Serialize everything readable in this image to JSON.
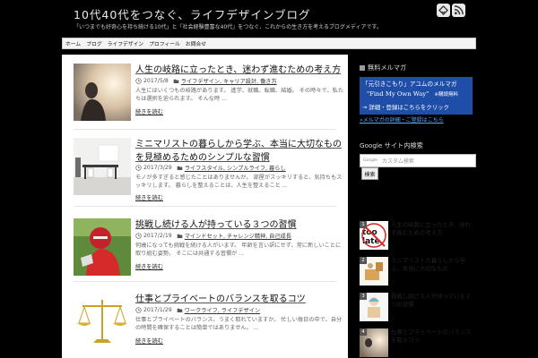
{
  "header": {
    "title": "10代40代をつなぐ、ライフデザインブログ",
    "description": "「いつまでも好奇心を持ち続ける10代」と「社会経験豊富な40代」をつなぐ、これからの生き方を考えるブログメディアです。",
    "icons": [
      "feedly-icon",
      "rss-icon"
    ]
  },
  "nav": {
    "items": [
      "ホーム",
      "ブログ",
      "ライフデザイン",
      "プロフィール",
      "お問合せ"
    ]
  },
  "posts": [
    {
      "title": "人生の岐路に立ったとき、迷わず進むための考え方",
      "date": "2017/5/8",
      "categories": "ライフデザイン, キャリア設計, 働き方",
      "excerpt": "人生にはいくつもの岐路があります。 進学、就職、転職、結婚。 その時々で、私たちは選択を迫られます。 そんな時 ...",
      "more": "続きを読む"
    },
    {
      "title": "ミニマリストの暮らしから学ぶ、本当に大切なものを見極めるためのシンプルな習慣",
      "date": "2017/3/29",
      "categories": "ライフスタイル, シンプルライフ, 暮らし",
      "excerpt": "モノが多すぎると感じたことはありませんか。 部屋がスッキリすると、気持ちもスッキリします。 暮らしを整えることは、人生を整えること ...",
      "more": "続きを読む"
    },
    {
      "title": "挑戦し続ける人が持っている３つの習慣",
      "date": "2017/2/19",
      "categories": "マインドセット, チャレンジ精神, 自己成長",
      "excerpt": "何歳になっても挑戦を続ける人がいます。 年齢を言い訳にせず、常に新しいことに取り組む姿勢。 そこには共通する習慣が ...",
      "more": "続きを読む"
    },
    {
      "title": "仕事とプライベートのバランスを取るコツ",
      "date": "2017/1/29",
      "categories": "ワークライフ, ライフデザイン",
      "excerpt": "仕事とプライベートのバランス、うまく取れていますか。 忙しい毎日の中で、自分の時間を確保することは簡単ではありません。 ...",
      "more": "続きを読む"
    }
  ],
  "sidebar": {
    "mailmag_heading": "無料メルマガ",
    "banner": {
      "line1": "「元引きこもり」アユムのメルマガ",
      "line2": "\"Find My Own Way\"",
      "line2_note": "※購読無料",
      "line3": "→ 詳細・登録はこちらをクリック"
    },
    "banner_link": "»メルマガの詳細・ご登録はこちら",
    "search_heading": "Google サイト内検索",
    "search": {
      "brand": "Google",
      "placeholder": "カスタム検索",
      "button": "検索"
    },
    "ranking": [
      {
        "rank": "1",
        "title": "人生の岐路に立ったとき、迷わず進むための考え方"
      },
      {
        "rank": "2",
        "title": "ミニマリストの暮らしから学ぶ、本当に大切なもの"
      },
      {
        "rank": "3",
        "title": "挑戦し続ける人が持っている３つの習慣"
      },
      {
        "rank": "4",
        "title": "仕事とプライベートのバランスを取るコツ"
      }
    ]
  },
  "colors": {
    "background": "#000000",
    "main_bg": "#ffffff",
    "banner": "#1f4ea8",
    "link_blue": "#5aa9ff"
  }
}
